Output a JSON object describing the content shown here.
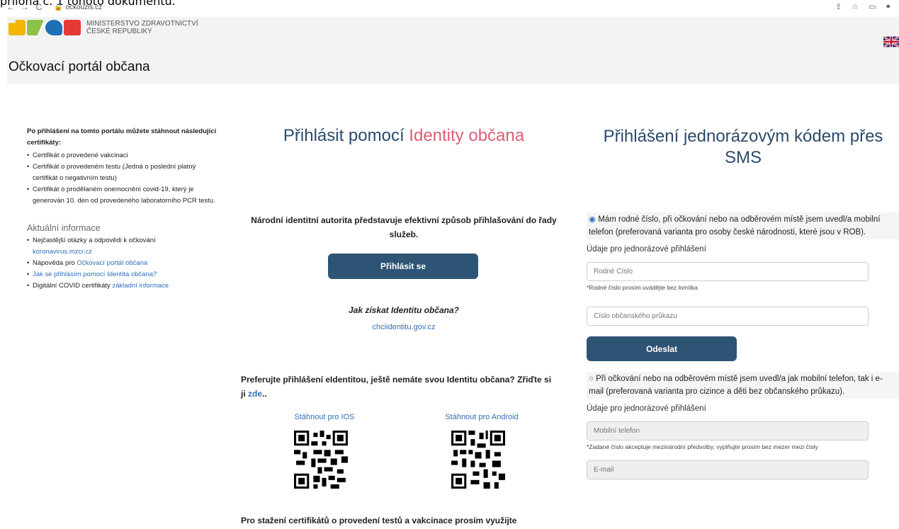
{
  "doc": {
    "line": "příloha č. 1 tohoto dokumentu."
  },
  "browser": {
    "url": "ockouzis.cz"
  },
  "header": {
    "ministry_line1": "Ministerstvo zdravotnictví",
    "ministry_line2": "České republiky",
    "portal_title": "Očkovací portál občana"
  },
  "left": {
    "intro": "Po přihlášení na tomto portálu můžete stáhnout následující certifikáty:",
    "certs": [
      "Certifikát o provedené vakcinaci",
      "Certifikát o provedeném testu (Jedná o poslední platný certifikát o negativním testu)",
      "Certifikát o prodělaném onemocnění covid-19, který je generován 10. den od provedeného laboratorního PCR testu."
    ],
    "info_title": "Aktuální informace",
    "info": {
      "item1_text": "Nejčastější otázky a odpovědi k očkování",
      "item1_link": "koronavirus.mzcr.cz",
      "item2_text": "Nápověda pro ",
      "item2_link": "Očkovací portál občana",
      "item3_link": "Jak se přihlásím pomocí Identita občana?",
      "item4_text": "Digitální COVID certifikáty ",
      "item4_link": "základní informace"
    }
  },
  "middle": {
    "title_bold": "Přihlásit pomocí",
    "title_light": "Identity občana",
    "nia_text": "Národní identitní autorita představuje efektivní způsob přihlašování do řady služeb.",
    "login_button": "Přihlásit se",
    "how_title": "Jak získat Identitu občana?",
    "how_link": "chciidentitu.gov.cz",
    "prefer_text": "Preferujte přihlášení eIdentitou, ještě nemáte svou Identitu občana? Zřiďte si ji ",
    "prefer_link": "zde",
    "prefer_after": "..",
    "download_ios": "Stáhnout pro IOS",
    "download_android": "Stáhnout pro Android",
    "bottom_text": "Pro stažení certifikátů o provedení testů a vakcinace prosím využijte"
  },
  "right": {
    "title": "Přihlášení jednorázovým kódem přes SMS",
    "option1": "Mám rodné číslo, při očkování nebo na odběrovém místě jsem uvedl/a mobilní telefon (preferovaná varianta pro osoby české národnosti, které jsou v ROB).",
    "section_label": "Údaje pro jednorázové přihlášení",
    "birth_number_placeholder": "Rodné Číslo",
    "birth_number_note": "*Rodné číslo prosím uvádějte bez lomítka",
    "id_card_placeholder": "Číslo občanského průkazu",
    "send_button": "Odeslat",
    "option2": "Při očkování nebo na odběrovém místě jsem uvedl/a jak mobilní telefon, tak i e-mail (preferovaná varianta pro cizince a děti bez občanského průkazu).",
    "section_label2": "Údaje pro jednorázové přihlášení",
    "phone_placeholder": "Mobilní telefon",
    "phone_note": "*Zadané číslo akceptuje mezinárodní předvolby, vyplňujte prosím bez mezer mezi čísly",
    "email_placeholder": "E-mail"
  },
  "colors": {
    "primary": "#2e5475",
    "accent": "#d95f76",
    "link": "#2f6fb7"
  }
}
